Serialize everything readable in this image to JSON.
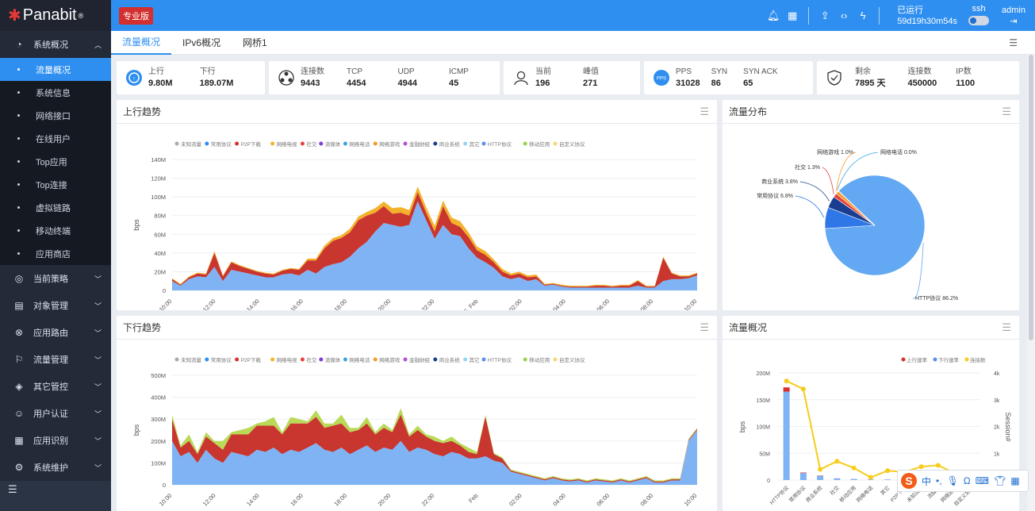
{
  "brand": {
    "name": "Panabit",
    "registered": "®",
    "edition": "专业版"
  },
  "topbar": {
    "uptime_label": "已运行",
    "uptime_value": "59d19h30m54s",
    "ssh_label": "ssh",
    "admin_label": "admin",
    "icons": [
      "bell-icon",
      "qrcode-icon",
      "upload-icon",
      "code-icon",
      "bolt-icon",
      "logout-icon"
    ]
  },
  "sidebar": {
    "groups": [
      {
        "label": "系统概况",
        "icon": "dashboard-icon",
        "expanded": true,
        "items": [
          "流量概况",
          "系统信息",
          "网络接口",
          "在线用户",
          "Top应用",
          "Top连接",
          "虚拟链路",
          "移动终端",
          "应用商店"
        ],
        "active": "流量概况"
      },
      {
        "label": "当前策略",
        "icon": "location-icon"
      },
      {
        "label": "对象管理",
        "icon": "database-icon"
      },
      {
        "label": "应用路由",
        "icon": "route-icon"
      },
      {
        "label": "流量管理",
        "icon": "flag-icon"
      },
      {
        "label": "其它管控",
        "icon": "layers-icon"
      },
      {
        "label": "用户认证",
        "icon": "user-icon"
      },
      {
        "label": "应用识别",
        "icon": "apps-icon"
      },
      {
        "label": "系统维护",
        "icon": "settings-icon"
      }
    ]
  },
  "tabs": [
    {
      "label": "流量概况",
      "active": true
    },
    {
      "label": "IPv6概况"
    },
    {
      "label": "网桥1"
    }
  ],
  "stats": {
    "traffic": {
      "up_label": "上行",
      "up_value": "9.80M",
      "down_label": "下行",
      "down_value": "189.07M"
    },
    "conn": {
      "conn_label": "连接数",
      "conn_value": "9443",
      "tcp_label": "TCP",
      "tcp_value": "4454",
      "udp_label": "UDP",
      "udp_value": "4944",
      "icmp_label": "ICMP",
      "icmp_value": "45"
    },
    "users": {
      "cur_label": "当前",
      "cur_value": "196",
      "peak_label": "峰值",
      "peak_value": "271"
    },
    "pps": {
      "icon_text": "PPS",
      "pps_label": "PPS",
      "pps_value": "31028",
      "syn_label": "SYN",
      "syn_value": "86",
      "synack_label": "SYN ACK",
      "synack_value": "65"
    },
    "license": {
      "remain_label": "剩余",
      "remain_value": "7895 天",
      "conn_label": "连接数",
      "conn_value": "450000",
      "ip_label": "IP数",
      "ip_value": "1100"
    }
  },
  "panels": {
    "up_title": "上行趋势",
    "dist_title": "流量分布",
    "down_title": "下行趋势",
    "overview_title": "流量概况"
  },
  "colors": {
    "accent": "#2f8ff0",
    "sidebar": "#2b3445",
    "active": "#2f8ff0"
  },
  "chart_data": [
    {
      "type": "area",
      "title": "上行趋势",
      "ylabel": "bps",
      "y_ticks": [
        "0",
        "20M",
        "40M",
        "60M",
        "80M",
        "100M",
        "120M",
        "140M"
      ],
      "ylim": [
        0,
        140
      ],
      "x_ticks": [
        "10:00",
        "12:00",
        "14:00",
        "16:00",
        "18:00",
        "20:00",
        "22:00",
        "25. Feb",
        "02:00",
        "04:00",
        "06:00",
        "08:00",
        "10:00"
      ],
      "legend": [
        "未知流量",
        "常用协议",
        "P2P下载",
        "网络电视",
        "社交",
        "流媒体",
        "网络电话",
        "网络游戏",
        "金融财经",
        "商业系统",
        "其它",
        "HTTP协议",
        "移动应用",
        "自定义协议"
      ],
      "legend_colors": [
        "#aaaaaa",
        "#2f8ff0",
        "#d9302f",
        "#f3b22a",
        "#e8413c",
        "#7b3fd1",
        "#3aa5e0",
        "#f59a23",
        "#b24fd6",
        "#1a3e8f",
        "#8fd8f2",
        "#5b8ff0",
        "#9ad24c",
        "#f7d774"
      ],
      "series": [
        {
          "name": "HTTP协议",
          "values": [
            10,
            5,
            12,
            15,
            14,
            25,
            10,
            22,
            20,
            18,
            16,
            14,
            14,
            17,
            18,
            16,
            22,
            18,
            25,
            28,
            30,
            36,
            45,
            52,
            63,
            72,
            70,
            68,
            70,
            95,
            75,
            55,
            70,
            60,
            58,
            45,
            35,
            30,
            24,
            15,
            12,
            14,
            10,
            12,
            5,
            6,
            4,
            3,
            3,
            3,
            3,
            3,
            3,
            3,
            3,
            5,
            3,
            3,
            10,
            12,
            12,
            13,
            16
          ]
        },
        {
          "name": "P2P下载",
          "values": [
            2,
            1,
            2,
            3,
            3,
            15,
            5,
            8,
            6,
            5,
            4,
            4,
            3,
            4,
            5,
            6,
            10,
            14,
            20,
            25,
            26,
            26,
            30,
            28,
            20,
            18,
            12,
            15,
            10,
            10,
            8,
            8,
            20,
            12,
            10,
            12,
            8,
            8,
            6,
            5,
            4,
            4,
            4,
            3,
            1,
            1,
            1,
            1,
            1,
            1,
            2,
            2,
            1,
            2,
            2,
            5,
            1,
            1,
            25,
            6,
            3,
            2,
            2
          ]
        },
        {
          "name": "常用协议",
          "values": [
            1,
            1,
            1,
            1,
            1,
            2,
            1,
            1,
            1,
            1,
            1,
            1,
            1,
            1,
            1,
            1,
            2,
            2,
            3,
            3,
            3,
            4,
            4,
            4,
            5,
            5,
            6,
            6,
            6,
            6,
            6,
            6,
            6,
            6,
            6,
            5,
            4,
            4,
            3,
            3,
            2,
            2,
            2,
            2,
            1,
            1,
            1,
            1,
            1,
            1,
            1,
            1,
            1,
            1,
            1,
            1,
            1,
            1,
            1,
            1,
            1,
            1,
            1
          ]
        }
      ]
    },
    {
      "type": "pie",
      "title": "流量分布",
      "slices": [
        {
          "label": "HTTP协议 86.2%",
          "value": 86.2,
          "color": "#62a8f2"
        },
        {
          "label": "常用协议 6.8%",
          "value": 6.8,
          "color": "#2f76e6"
        },
        {
          "label": "商业系统 3.8%",
          "value": 3.8,
          "color": "#1a3e8f"
        },
        {
          "label": "社交 1.3%",
          "value": 1.3,
          "color": "#e8413c"
        },
        {
          "label": "网络游戏 1.0%",
          "value": 1.0,
          "color": "#f59a23"
        },
        {
          "label": "网络电话 0.0%",
          "value": 0.0,
          "color": "#3aa5e0"
        }
      ]
    },
    {
      "type": "area",
      "title": "下行趋势",
      "ylabel": "bps",
      "y_ticks": [
        "0",
        "100M",
        "200M",
        "300M",
        "400M",
        "500M"
      ],
      "ylim": [
        0,
        500
      ],
      "x_ticks": [
        "10:00",
        "12:00",
        "14:00",
        "16:00",
        "18:00",
        "20:00",
        "22:00",
        "Feb",
        "02:00",
        "04:00",
        "06:00",
        "08:00",
        "10:00"
      ],
      "legend": [
        "未知流量",
        "常用协议",
        "P2P下载",
        "网络电视",
        "社交",
        "流媒体",
        "网络电话",
        "网络游戏",
        "金融财经",
        "商业系统",
        "其它",
        "HTTP协议",
        "移动应用",
        "自定义协议"
      ],
      "series": [
        {
          "name": "HTTP协议",
          "values": [
            200,
            130,
            150,
            100,
            160,
            120,
            100,
            150,
            140,
            130,
            160,
            150,
            170,
            140,
            160,
            150,
            170,
            190,
            160,
            150,
            170,
            140,
            160,
            180,
            150,
            170,
            160,
            200,
            150,
            170,
            160,
            140,
            130,
            150,
            140,
            120,
            120,
            130,
            110,
            100,
            60,
            50,
            40,
            30,
            20,
            30,
            20,
            15,
            20,
            10,
            20,
            15,
            10,
            20,
            10,
            20,
            30,
            10,
            10,
            20,
            20,
            200,
            250
          ]
        },
        {
          "name": "P2P下载",
          "values": [
            100,
            40,
            50,
            40,
            60,
            70,
            60,
            80,
            90,
            100,
            110,
            120,
            100,
            90,
            120,
            130,
            110,
            120,
            100,
            120,
            110,
            100,
            90,
            100,
            80,
            90,
            80,
            120,
            70,
            80,
            60,
            60,
            60,
            50,
            40,
            30,
            20,
            180,
            30,
            20,
            5,
            5,
            5,
            5,
            5,
            5,
            5,
            5,
            5,
            5,
            5,
            5,
            5,
            5,
            5,
            5,
            5,
            5,
            5,
            5,
            5,
            5,
            5
          ]
        },
        {
          "name": "移动应用",
          "values": [
            20,
            10,
            30,
            10,
            20,
            10,
            40,
            10,
            20,
            30,
            10,
            20,
            40,
            10,
            30,
            20,
            10,
            30,
            20,
            10,
            40,
            20,
            10,
            30,
            10,
            20,
            10,
            30,
            10,
            20,
            10,
            20,
            10,
            20,
            10,
            20,
            10,
            10,
            5,
            5,
            5,
            5,
            5,
            5,
            5,
            5,
            5,
            5,
            5,
            5,
            5,
            5,
            5,
            5,
            5,
            5,
            5,
            5,
            5,
            5,
            5,
            5,
            5
          ]
        }
      ]
    },
    {
      "type": "bar",
      "title": "流量概况",
      "ylabel": "bps",
      "y2label": "Session#",
      "y_ticks": [
        "0",
        "50M",
        "100M",
        "150M",
        "200M"
      ],
      "y2_ticks": [
        "1k",
        "2k",
        "3k",
        "4k"
      ],
      "ylim": [
        0,
        200
      ],
      "y2lim": [
        0,
        4000
      ],
      "legend": [
        "上行速率",
        "下行速率",
        "连接数"
      ],
      "legend_colors": [
        "#d9302f",
        "#5b8ff0",
        "#f7cc1a"
      ],
      "categories": [
        "HTTP协议",
        "常用协议",
        "商业系统",
        "社交",
        "移动应用",
        "网络电话",
        "其它",
        "P2P下载",
        "未知流量",
        "流媒体",
        "网络游戏",
        "自定义协议"
      ],
      "series": [
        {
          "name": "上行速率",
          "values": [
            8,
            1,
            0.5,
            0.2,
            0.1,
            0.1,
            0.1,
            0.1,
            0.1,
            0.1,
            0.1,
            0.1
          ]
        },
        {
          "name": "下行速率",
          "values": [
            165,
            13,
            8,
            3,
            2,
            1,
            1,
            1,
            0.5,
            0.5,
            0.3,
            0.2
          ]
        },
        {
          "name": "连接数",
          "values": [
            3700,
            3400,
            400,
            700,
            450,
            100,
            350,
            300,
            500,
            550,
            250,
            150
          ]
        }
      ]
    }
  ]
}
